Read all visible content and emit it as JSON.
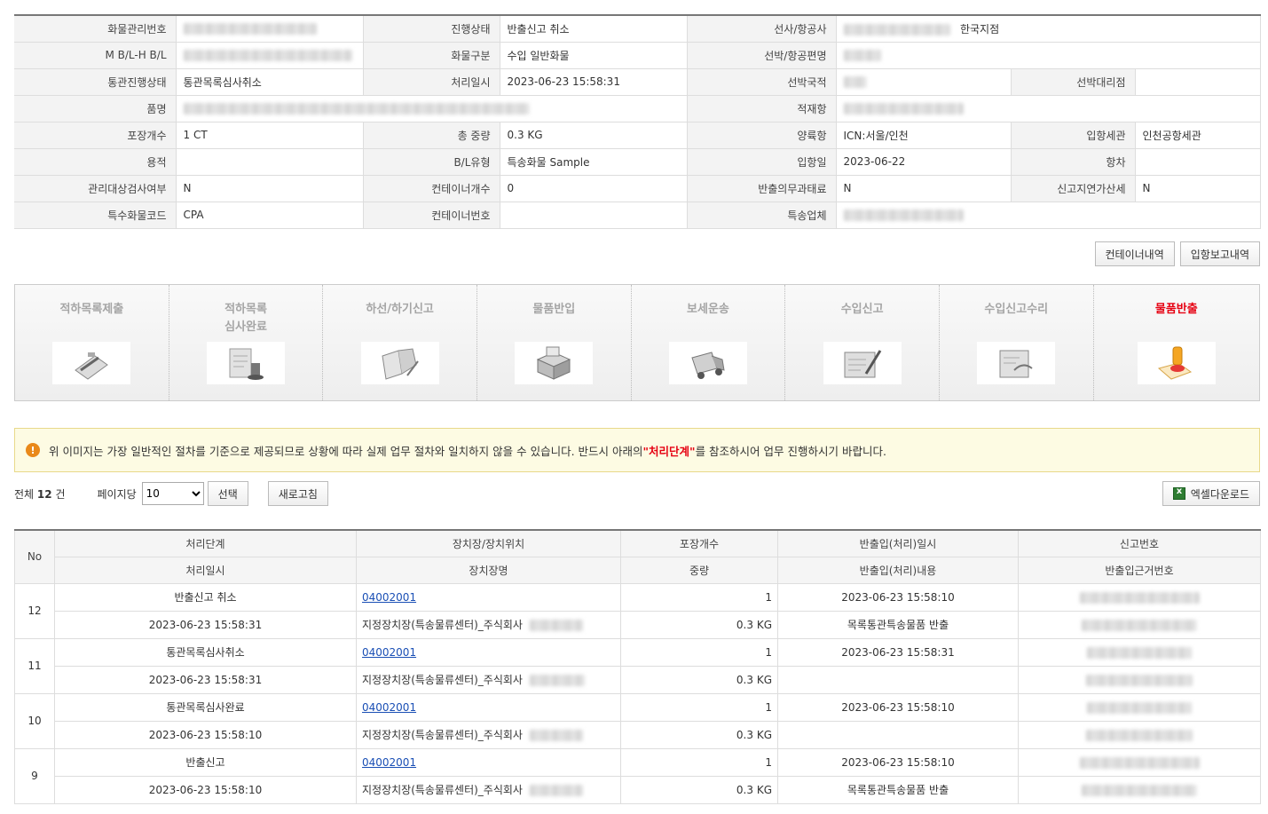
{
  "info": {
    "cargo_no_label": "화물관리번호",
    "status_label": "진행상태",
    "status_value": "반출신고 취소",
    "carrier_label": "선사/항공사",
    "carrier_suffix": "한국지점",
    "mbl_label": "M B/L-H B/L",
    "cargo_type_label": "화물구분",
    "cargo_type_value": "수입 일반화물",
    "vessel_label": "선박/항공편명",
    "customs_status_label": "통관진행상태",
    "customs_status_value": "통관목록심사취소",
    "proc_date_label": "처리일시",
    "proc_date_value": "2023-06-23 15:58:31",
    "nationality_label": "선박국적",
    "agent_label": "선박대리점",
    "item_label": "품명",
    "loading_port_label": "적재항",
    "pkg_label": "포장개수",
    "pkg_value": "1 CT",
    "weight_label": "총 중량",
    "weight_value": "0.3 KG",
    "unloading_port_label": "양륙항",
    "unloading_port_value": "ICN:서울/인천",
    "entry_customs_label": "입항세관",
    "entry_customs_value": "인천공항세관",
    "volume_label": "용적",
    "bl_type_label": "B/L유형",
    "bl_type_value": "특송화물 Sample",
    "entry_date_label": "입항일",
    "entry_date_value": "2023-06-22",
    "voyage_label": "항차",
    "inspect_label": "관리대상검사여부",
    "inspect_value": "N",
    "container_cnt_label": "컨테이너개수",
    "container_cnt_value": "0",
    "release_duty_label": "반출의무과태료",
    "release_duty_value": "N",
    "late_fee_label": "신고지연가산세",
    "late_fee_value": "N",
    "special_code_label": "특수화물코드",
    "special_code_value": "CPA",
    "container_no_label": "컨테이너번호",
    "courier_label": "특송업체"
  },
  "buttons": {
    "container_history": "컨테이너내역",
    "entry_report": "입항보고내역"
  },
  "steps": [
    {
      "line1": "적하목록제출",
      "line2": "",
      "icon": "clipboard-pen-icon"
    },
    {
      "line1": "적하목록",
      "line2": "심사완료",
      "icon": "stamp-document-icon"
    },
    {
      "line1": "하선/하기신고",
      "line2": "",
      "icon": "open-book-icon"
    },
    {
      "line1": "물품반입",
      "line2": "",
      "icon": "boxes-icon"
    },
    {
      "line1": "보세운송",
      "line2": "",
      "icon": "truck-icon"
    },
    {
      "line1": "수입신고",
      "line2": "",
      "icon": "signing-document-icon"
    },
    {
      "line1": "수입신고수리",
      "line2": "",
      "icon": "approval-document-icon"
    },
    {
      "line1": "물품반출",
      "line2": "",
      "icon": "seal-stamp-icon"
    }
  ],
  "notice": {
    "text_before": "위 이미지는 가장 일반적인 절차를 기준으로 제공되므로 상황에 따라 실제 업무 절차와 일치하지 않을 수 있습니다. 반드시 아래의 ",
    "highlight": "\"처리단계\"",
    "text_after": "를 참조하시어 업무 진행하시기 바랍니다."
  },
  "list_ctrl": {
    "total_prefix": "전체",
    "total_count": "12",
    "total_suffix": "건",
    "per_page_label": "페이지당",
    "per_page_value": "10",
    "select_button": "선택",
    "refresh_button": "새로고침",
    "excel_button": "엑셀다운로드"
  },
  "table_head": {
    "no": "No",
    "step": "처리단계",
    "proc_date": "처리일시",
    "warehouse": "장치장/장치위치",
    "warehouse_name": "장치장명",
    "pkg": "포장개수",
    "weight": "중량",
    "io_date": "반출입(처리)일시",
    "io_content": "반출입(처리)내용",
    "report_no": "신고번호",
    "io_basis": "반출입근거번호"
  },
  "rows": [
    {
      "no": "12",
      "step": "반출신고 취소",
      "code": "04002001",
      "pkg": "1",
      "io_date": "2023-06-23 15:58:10",
      "proc_date": "2023-06-23 15:58:31",
      "wh_name": "지정장치장(특송물류센터)_주식회사",
      "weight": "0.3 KG",
      "io_content": "목록통관특송물품 반출"
    },
    {
      "no": "11",
      "step": "통관목록심사취소",
      "code": "04002001",
      "pkg": "1",
      "io_date": "2023-06-23 15:58:31",
      "proc_date": "2023-06-23 15:58:31",
      "wh_name": "지정장치장(특송물류센터)_주식회사",
      "weight": "0.3 KG",
      "io_content": ""
    },
    {
      "no": "10",
      "step": "통관목록심사완료",
      "code": "04002001",
      "pkg": "1",
      "io_date": "2023-06-23 15:58:10",
      "proc_date": "2023-06-23 15:58:10",
      "wh_name": "지정장치장(특송물류센터)_주식회사",
      "weight": "0.3 KG",
      "io_content": ""
    },
    {
      "no": "9",
      "step": "반출신고",
      "code": "04002001",
      "pkg": "1",
      "io_date": "2023-06-23 15:58:10",
      "proc_date": "2023-06-23 15:58:10",
      "wh_name": "지정장치장(특송물류센터)_주식회사",
      "weight": "0.3 KG",
      "io_content": "목록통관특송물품 반출"
    }
  ]
}
